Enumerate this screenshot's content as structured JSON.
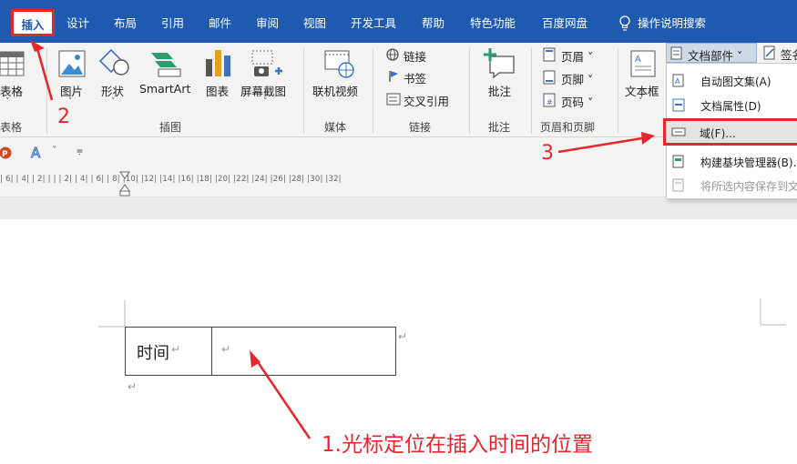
{
  "tabs": [
    {
      "label": "插入",
      "active": true
    },
    {
      "label": "设计"
    },
    {
      "label": "布局"
    },
    {
      "label": "引用"
    },
    {
      "label": "邮件"
    },
    {
      "label": "审阅"
    },
    {
      "label": "视图"
    },
    {
      "label": "开发工具"
    },
    {
      "label": "帮助"
    },
    {
      "label": "特色功能"
    },
    {
      "label": "百度网盘"
    },
    {
      "label": "操作说明搜索"
    }
  ],
  "ribbon": {
    "table": {
      "label": "表格",
      "group": "表格"
    },
    "illustrations": {
      "group": "插图",
      "items": [
        {
          "label": "图片"
        },
        {
          "label": "形状"
        },
        {
          "label": "SmartArt"
        },
        {
          "label": "图表"
        },
        {
          "label": "屏幕截图"
        }
      ]
    },
    "media": {
      "label": "联机视频",
      "group": "媒体"
    },
    "links": {
      "group": "链接",
      "items": [
        "链接",
        "书签",
        "交叉引用"
      ]
    },
    "comments": {
      "label": "批注",
      "group": "批注"
    },
    "header_footer": {
      "group": "页眉和页脚",
      "items": [
        "页眉 ˅",
        "页脚 ˅",
        "页码 ˅"
      ]
    },
    "text": {
      "textbox_label": "文本框",
      "quick_parts_label": "文档部件 ˅",
      "signature_label": "签名"
    }
  },
  "menu": {
    "items": [
      {
        "label": "自动图文集(A)",
        "icon": "autotext-icon"
      },
      {
        "label": "文档属性(D)",
        "icon": "document-property-icon"
      },
      {
        "label": "域(F)...",
        "icon": "field-icon",
        "highlight": true
      },
      {
        "label": "构建基块管理器(B)...",
        "icon": "building-blocks-icon"
      },
      {
        "label": "将所选内容保存到文档部件库(S)...",
        "icon": "save-selection-icon",
        "disabled": true
      }
    ]
  },
  "ruler": {
    "text": "| 6|  | 4|  | 2|  |   |  | 2|  | 4|  | 6|  | 8|  |10|  |12|  |14|  |16|  |18|  |20|  |22|  |24|  |26|  |28|  |30|  |32|"
  },
  "document": {
    "cell1": "时间",
    "paragraph_mark": "↵"
  },
  "annotations": {
    "step1": "1.光标定位在插入时间的位置",
    "step2": "2",
    "step3": "3",
    "color": "#e8252a"
  },
  "colors": {
    "ribbon_blue": "#1e5bb0",
    "highlight_red": "#e8252a"
  }
}
